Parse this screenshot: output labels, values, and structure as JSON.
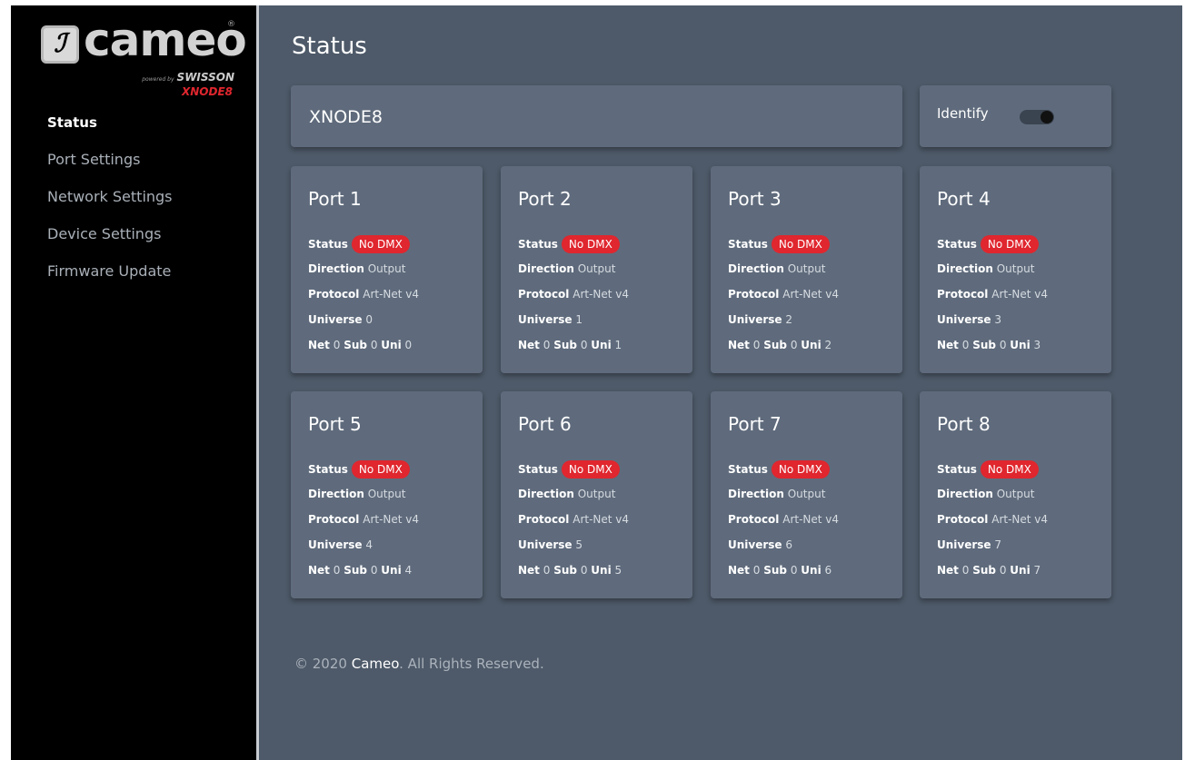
{
  "logo": {
    "mark": "ℐ",
    "word": "cameo",
    "reg": "®",
    "powered_pre": "powered by",
    "powered_brand": "SWISSON",
    "model": "XNODE8"
  },
  "sidebar": {
    "items": [
      {
        "label": "Status"
      },
      {
        "label": "Port Settings"
      },
      {
        "label": "Network Settings"
      },
      {
        "label": "Device Settings"
      },
      {
        "label": "Firmware Update"
      }
    ]
  },
  "page": {
    "title": "Status"
  },
  "device": {
    "name": "XNODE8"
  },
  "identify": {
    "label": "Identify",
    "on": false
  },
  "labels": {
    "status": "Status",
    "direction": "Direction",
    "protocol": "Protocol",
    "universe": "Universe",
    "net": "Net",
    "sub": "Sub",
    "uni": "Uni"
  },
  "ports": [
    {
      "title": "Port 1",
      "status": "No DMX",
      "direction": "Output",
      "protocol": "Art-Net v4",
      "universe": "0",
      "net": "0",
      "sub": "0",
      "uni": "0"
    },
    {
      "title": "Port 2",
      "status": "No DMX",
      "direction": "Output",
      "protocol": "Art-Net v4",
      "universe": "1",
      "net": "0",
      "sub": "0",
      "uni": "1"
    },
    {
      "title": "Port 3",
      "status": "No DMX",
      "direction": "Output",
      "protocol": "Art-Net v4",
      "universe": "2",
      "net": "0",
      "sub": "0",
      "uni": "2"
    },
    {
      "title": "Port 4",
      "status": "No DMX",
      "direction": "Output",
      "protocol": "Art-Net v4",
      "universe": "3",
      "net": "0",
      "sub": "0",
      "uni": "3"
    },
    {
      "title": "Port 5",
      "status": "No DMX",
      "direction": "Output",
      "protocol": "Art-Net v4",
      "universe": "4",
      "net": "0",
      "sub": "0",
      "uni": "4"
    },
    {
      "title": "Port 6",
      "status": "No DMX",
      "direction": "Output",
      "protocol": "Art-Net v4",
      "universe": "5",
      "net": "0",
      "sub": "0",
      "uni": "5"
    },
    {
      "title": "Port 7",
      "status": "No DMX",
      "direction": "Output",
      "protocol": "Art-Net v4",
      "universe": "6",
      "net": "0",
      "sub": "0",
      "uni": "6"
    },
    {
      "title": "Port 8",
      "status": "No DMX",
      "direction": "Output",
      "protocol": "Art-Net v4",
      "universe": "7",
      "net": "0",
      "sub": "0",
      "uni": "7"
    }
  ],
  "footer": {
    "prefix": "© 2020 ",
    "brand": "Cameo",
    "suffix": ". All Rights Reserved."
  },
  "colors": {
    "sidebar_bg": "#000000",
    "main_bg": "#4e5a69",
    "card_bg": "#5f6b7c",
    "badge_red": "#e0262e"
  }
}
